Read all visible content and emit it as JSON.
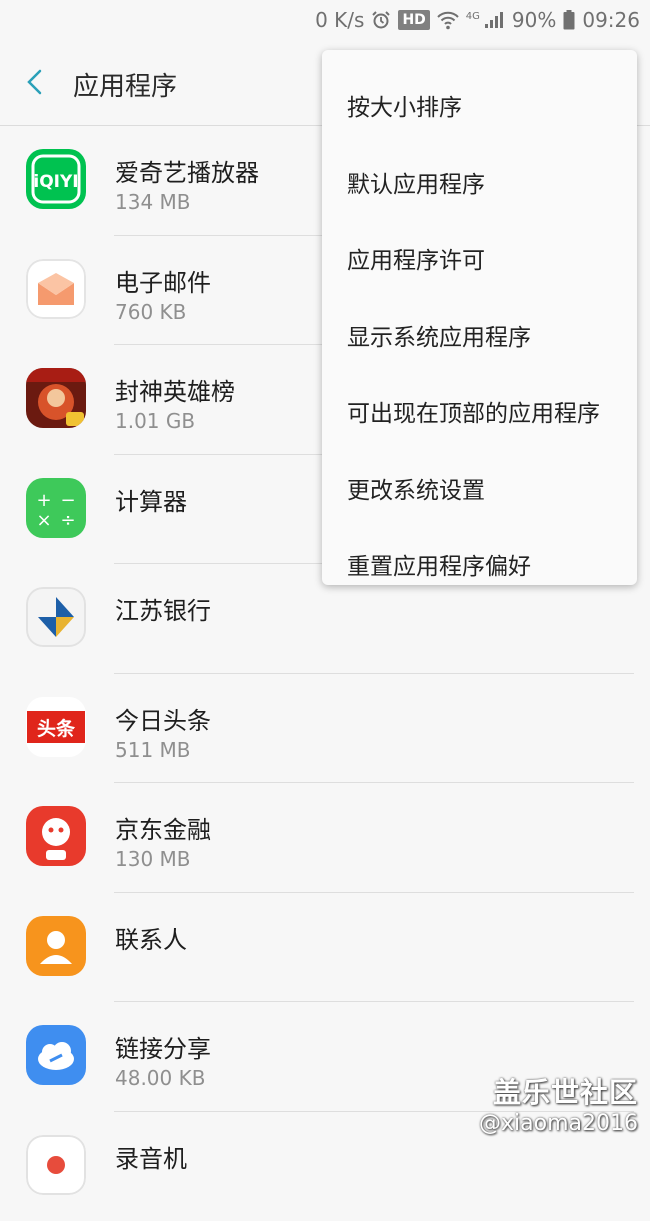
{
  "status_bar": {
    "net_speed": "0 K/s",
    "hd_badge": "HD",
    "network": "4G",
    "battery": "90%",
    "time": "09:26"
  },
  "header": {
    "title": "应用程序"
  },
  "apps": [
    {
      "name": "爱奇艺播放器",
      "size": "134 MB",
      "icon": "iqiyi-icon"
    },
    {
      "name": "电子邮件",
      "size": "760 KB",
      "icon": "email-icon"
    },
    {
      "name": "封神英雄榜",
      "size": "1.01 GB",
      "icon": "game-icon"
    },
    {
      "name": "计算器",
      "size": "",
      "icon": "calculator-icon"
    },
    {
      "name": "江苏银行",
      "size": "",
      "icon": "bank-icon"
    },
    {
      "name": "今日头条",
      "size": "511 MB",
      "icon": "toutiao-icon"
    },
    {
      "name": "京东金融",
      "size": "130 MB",
      "icon": "jd-finance-icon"
    },
    {
      "name": "联系人",
      "size": "",
      "icon": "contacts-icon"
    },
    {
      "name": "链接分享",
      "size": "48.00 KB",
      "icon": "link-share-icon"
    },
    {
      "name": "录音机",
      "size": "",
      "icon": "recorder-icon"
    }
  ],
  "menu": {
    "items": [
      "按大小排序",
      "默认应用程序",
      "应用程序许可",
      "显示系统应用程序",
      "可出现在顶部的应用程序",
      "更改系统设置",
      "重置应用程序偏好"
    ]
  },
  "watermark": {
    "title": "盖乐世社区",
    "handle": "@xiaoma2016"
  },
  "colors": {
    "accent": "#2aa0b8",
    "background": "#f7f7f7",
    "menu_bg": "#fafafa"
  }
}
